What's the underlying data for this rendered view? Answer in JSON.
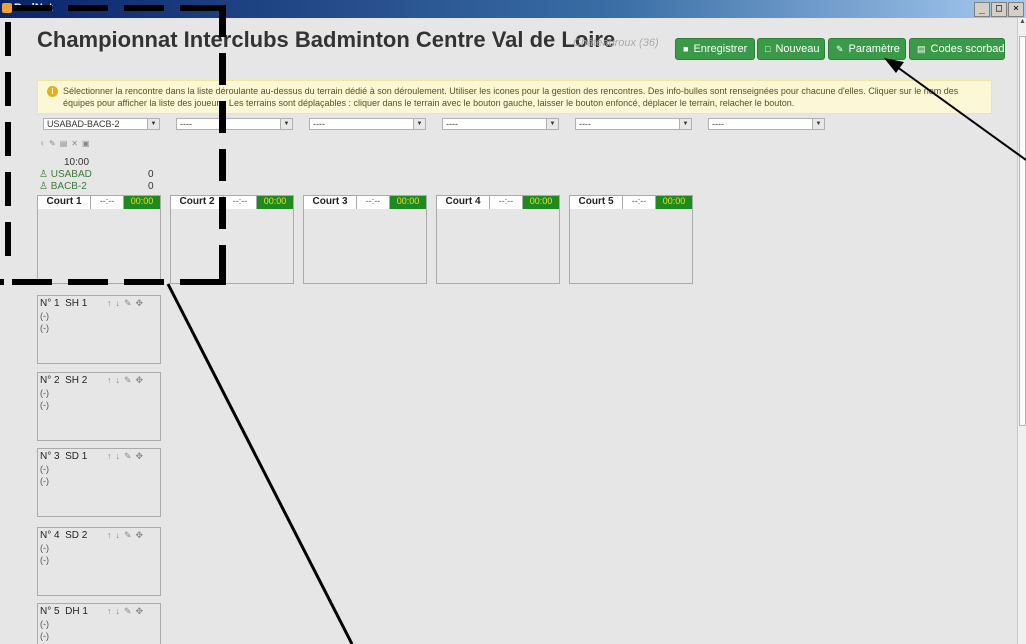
{
  "window": {
    "title": "BadNet",
    "controls": [
      "_",
      "□",
      "×"
    ]
  },
  "header": {
    "title": "Championnat Interclubs Badminton Centre Val de Loire",
    "subtitle": "Châteauroux (36)"
  },
  "toolbar": {
    "enregistrer": "Enregistrer",
    "nouveau": "Nouveau",
    "parametre": "Paramètre",
    "codes": "Codes scorbad"
  },
  "alert": {
    "text": "Sélectionner la rencontre dans la liste déroulante au-dessus du terrain dédié à son déroulement. Utiliser les icones pour la gestion des rencontres. Des info-bulles sont renseignées pour chacune d'elles. Cliquer sur le nom des équipes pour afficher la liste des joueurs. Les terrains sont déplaçables : cliquer dans le terrain avec le bouton gauche, laisser le bouton enfoncé, déplacer le terrain, relacher le bouton."
  },
  "selects": [
    "USABAD-BACB-2",
    "----",
    "----",
    "----",
    "----",
    "----"
  ],
  "encounter": {
    "time": "10:00",
    "team1": "USABAD",
    "score1": "0",
    "team2": "BACB-2",
    "score2": "0"
  },
  "courts": [
    {
      "name": "Court 1",
      "dash": "--:--",
      "time": "00:00"
    },
    {
      "name": "Court 2",
      "dash": "--:--",
      "time": "00:00"
    },
    {
      "name": "Court 3",
      "dash": "--:--",
      "time": "00:00"
    },
    {
      "name": "Court 4",
      "dash": "--:--",
      "time": "00:00"
    },
    {
      "name": "Court 5",
      "dash": "--:--",
      "time": "00:00"
    }
  ],
  "matches": [
    {
      "num": "N° 1",
      "type": "SH 1",
      "p1": "(-)",
      "p2": "(-)"
    },
    {
      "num": "N° 2",
      "type": "SH 2",
      "p1": "(-)",
      "p2": "(-)"
    },
    {
      "num": "N° 3",
      "type": "SD 1",
      "p1": "(-)",
      "p2": "(-)"
    },
    {
      "num": "N° 4",
      "type": "SD 2",
      "p1": "(-)",
      "p2": "(-)"
    },
    {
      "num": "N° 5",
      "type": "DH 1",
      "p1": "(-)",
      "p2": "(-)"
    }
  ],
  "colors": {
    "button_green": "#3a9a4a",
    "timer_bg": "#1f8a1f",
    "timer_text": "#f0e020",
    "team_green": "#3a7a3a",
    "alert_bg": "#fcf8d6"
  }
}
